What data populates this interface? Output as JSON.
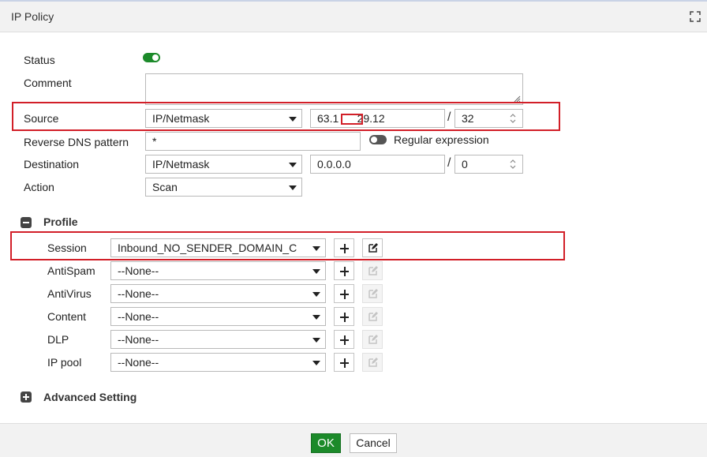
{
  "dialog": {
    "title": "IP Policy"
  },
  "form": {
    "status_label": "Status",
    "status_on": true,
    "comment_label": "Comment",
    "comment_value": "",
    "source_label": "Source",
    "source_type": "IP/Netmask",
    "source_ip": "63.1      29.12",
    "source_mask": "32",
    "reverse_dns_label": "Reverse DNS pattern",
    "reverse_dns_value": "*",
    "regex_label": "Regular expression",
    "regex_on": false,
    "destination_label": "Destination",
    "destination_type": "IP/Netmask",
    "destination_ip": "0.0.0.0",
    "destination_mask": "0",
    "action_label": "Action",
    "action_value": "Scan",
    "slash": "/"
  },
  "profile": {
    "section_label": "Profile",
    "rows": [
      {
        "label": "Session",
        "value": "Inbound_NO_SENDER_DOMAIN_C",
        "edit_enabled": true
      },
      {
        "label": "AntiSpam",
        "value": "--None--",
        "edit_enabled": false
      },
      {
        "label": "AntiVirus",
        "value": "--None--",
        "edit_enabled": false
      },
      {
        "label": "Content",
        "value": "--None--",
        "edit_enabled": false
      },
      {
        "label": "DLP",
        "value": "--None--",
        "edit_enabled": false
      },
      {
        "label": "IP pool",
        "value": "--None--",
        "edit_enabled": false
      }
    ]
  },
  "advanced": {
    "section_label": "Advanced Setting"
  },
  "footer": {
    "ok_label": "OK",
    "cancel_label": "Cancel"
  },
  "colors": {
    "accent_green": "#1c8a2a",
    "highlight_red": "#d21f28"
  }
}
